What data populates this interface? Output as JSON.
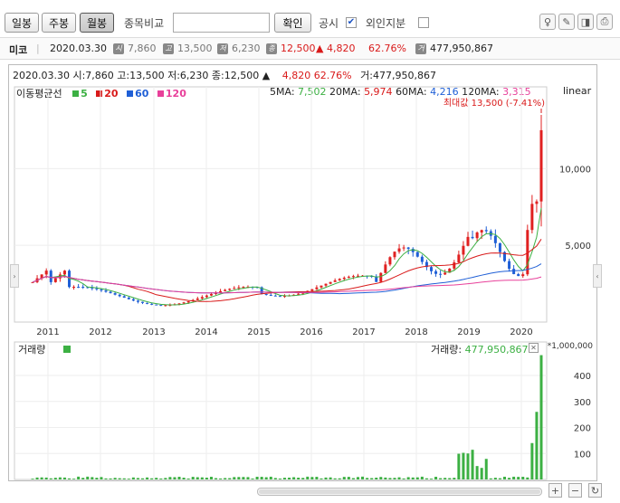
{
  "toolbar": {
    "period_tabs": [
      "일봉",
      "주봉",
      "월봉"
    ],
    "active_period": "월봉",
    "compare_label": "종목비교",
    "search_placeholder": "",
    "confirm_label": "확인",
    "disclosure_label": "공시",
    "disclosure_checked": true,
    "foreign_label": "외인지분",
    "foreign_checked": false
  },
  "summary": {
    "name": "미코",
    "date": "2020.03.30",
    "open_label": "시",
    "open": "7,860",
    "high_label": "고",
    "high": "13,500",
    "low_label": "저",
    "low": "6,230",
    "close_label": "종",
    "close": "12,500",
    "change": "▲ 4,820",
    "change_pct": "62.76%",
    "volume_label": "거",
    "volume": "477,950,867"
  },
  "chart_header": {
    "line": "2020.03.30 시:7,860 고:13,500 저:6,230 종:12,500 ▲",
    "change": "4,820  62.76%",
    "volume": "거:477,950,867"
  },
  "ma": {
    "label": "이동평균선",
    "periods": [
      "5",
      "20",
      "60",
      "120"
    ],
    "colors": [
      "#3cb043",
      "#d91a1a",
      "#1f5fd6",
      "#e8409a"
    ],
    "values_label": [
      "5MA:",
      "20MA:",
      "60MA:",
      "120MA:"
    ],
    "values": [
      "7,502",
      "5,974",
      "4,216",
      "3,315"
    ],
    "scale": "linear"
  },
  "max_note": "최대값 13,500 (-7.41%)",
  "volume_panel": {
    "label": "거래량",
    "value_label": "거래량:",
    "value": "477,950,867",
    "unit": "*1,000,000",
    "ticks": [
      "400",
      "300",
      "200",
      "100"
    ]
  },
  "chart_data": {
    "type": "candlestick",
    "x_labels": [
      "2011",
      "2012",
      "2013",
      "2014",
      "2015",
      "2016",
      "2017",
      "2018",
      "2019",
      "2020"
    ],
    "y_ticks": [
      "10,000",
      "5,000"
    ],
    "yscale": "linear",
    "ylim": [
      0,
      14500
    ],
    "volume_ylim": [
      0,
      480
    ]
  },
  "colors": {
    "up": "#e02020",
    "down": "#1f5fd6",
    "volume": "#3cb043"
  }
}
